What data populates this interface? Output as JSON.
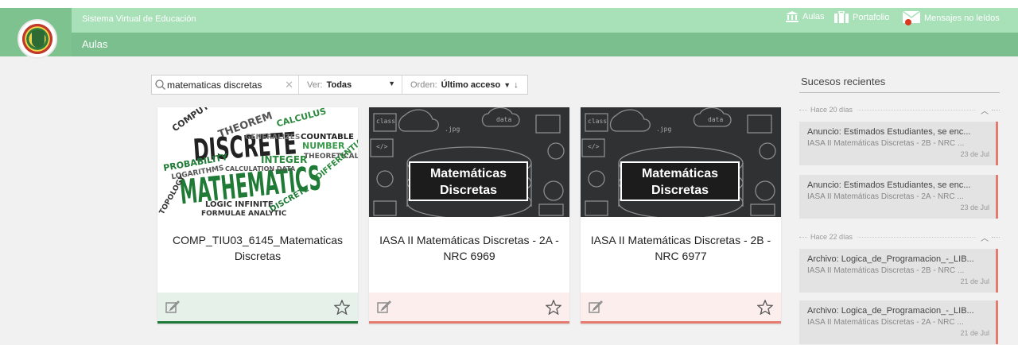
{
  "header": {
    "app_title": "Sistema Virtual de Educación",
    "section": "Aulas",
    "nav": [
      {
        "label": "Aulas",
        "icon": "bank-icon"
      },
      {
        "label": "Portafolio",
        "icon": "briefcase-icon"
      },
      {
        "label": "Mensajes no leídos",
        "icon": "envelope-icon"
      }
    ]
  },
  "filters": {
    "search_value": "matematicas discretas",
    "ver_label": "Ver:",
    "ver_value": "Todas",
    "orden_label": "Orden:",
    "orden_value": "Último acceso"
  },
  "courses": [
    {
      "title": "COMP_TIU03_6145_Matematicas Discretas",
      "image": "word-cloud-discrete-mathematics"
    },
    {
      "title": "IASA II Matemáticas Discretas - 2A - NRC 6969",
      "image_text": "Matemáticas Discretas"
    },
    {
      "title": "IASA II Matemáticas Discretas - 2B - NRC 6977",
      "image_text": "Matemáticas Discretas"
    }
  ],
  "sidebar": {
    "title": "Sucesos recientes",
    "groups": [
      {
        "label": "Hace 20 días",
        "events": [
          {
            "title": "Anuncio: Estimados Estudiantes, se enc...",
            "course": "IASA II Matemáticas Discretas - 2B - NRC ...",
            "date": "23 de Jul"
          },
          {
            "title": "Anuncio: Estimados Estudiantes, se enc...",
            "course": "IASA II Matemáticas Discretas - 2A - NRC ...",
            "date": "23 de Jul"
          }
        ]
      },
      {
        "label": "Hace 22 días",
        "events": [
          {
            "title": "Archivo: Logica_de_Programacion_-_LIB...",
            "course": "IASA II Matemáticas Discretas - 2B - NRC ...",
            "date": "21 de Jul"
          },
          {
            "title": "Archivo: Logica_de_Programacion_-_LIB...",
            "course": "IASA II Matemáticas Discretas - 2A - NRC ...",
            "date": "21 de Jul"
          }
        ]
      }
    ]
  },
  "colors": {
    "topbar": "#a8e0b8",
    "subbar": "#7cbf8e",
    "accent_green": "#1f7a3a",
    "accent_red": "#e47b70"
  }
}
